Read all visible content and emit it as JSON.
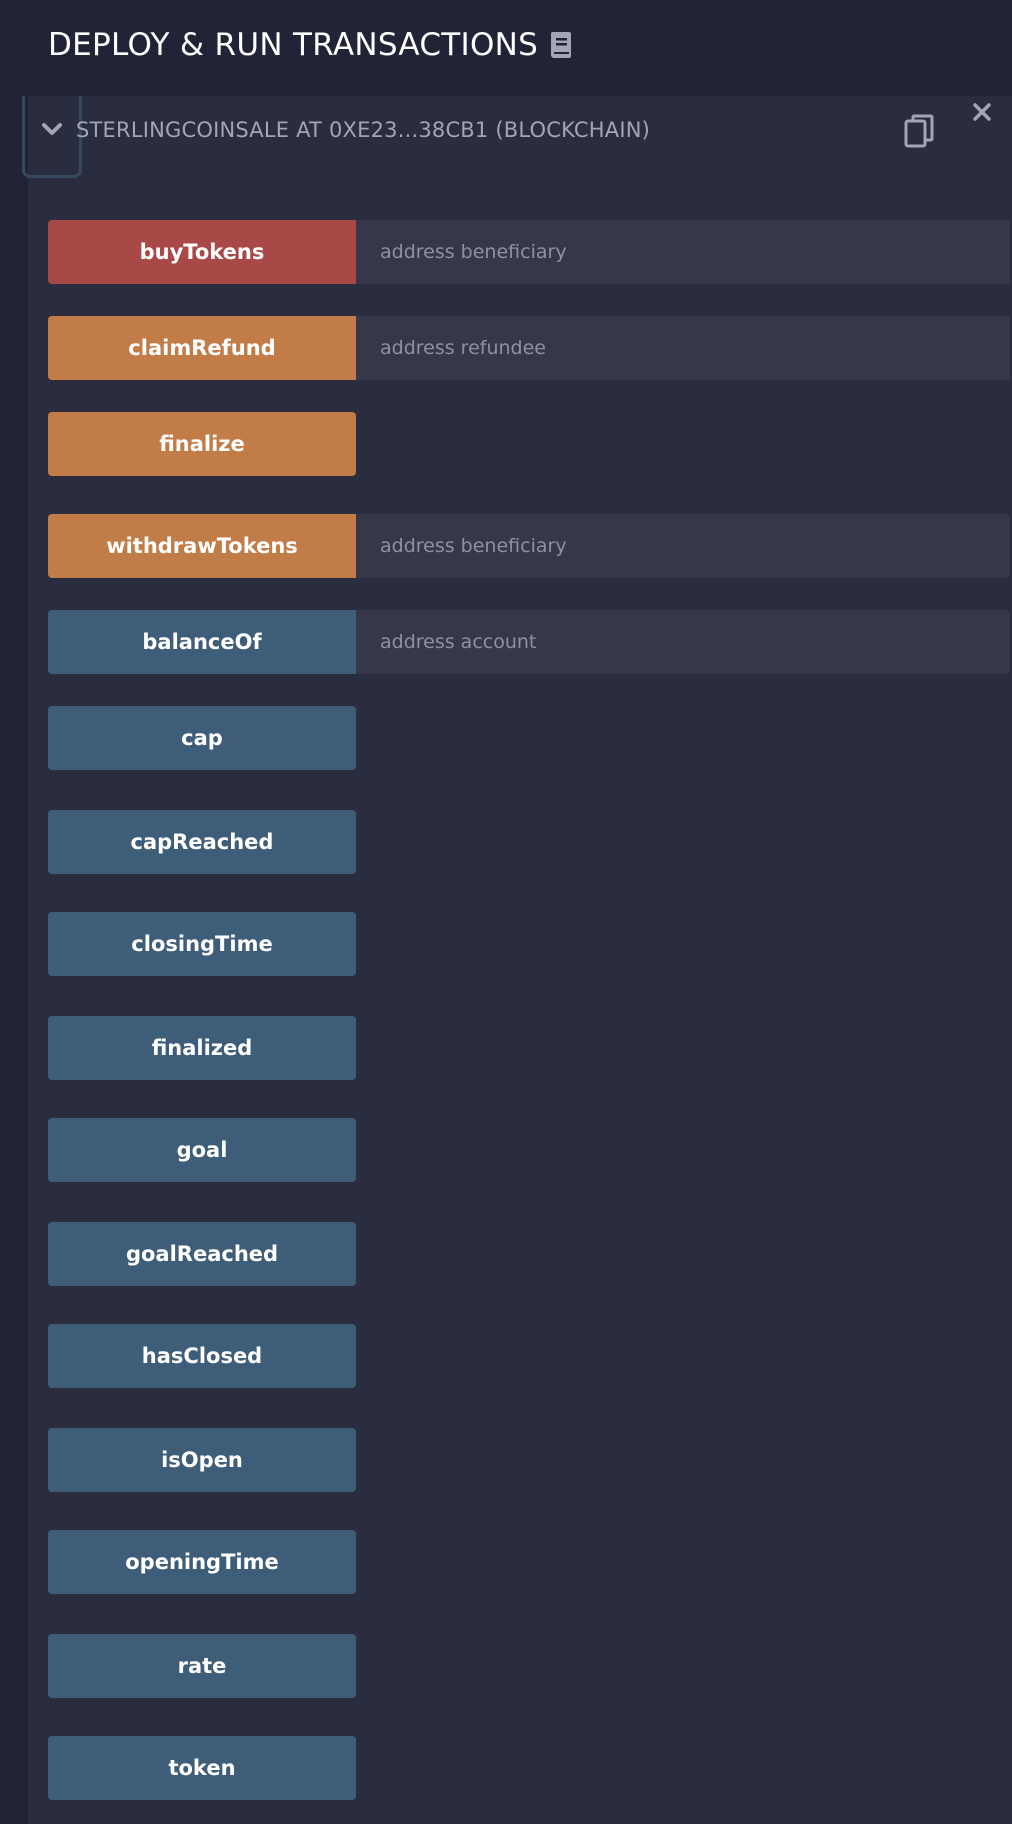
{
  "header": {
    "title": "DEPLOY & RUN TRANSACTIONS",
    "doc_icon": "book-icon"
  },
  "instance": {
    "title": "STERLINGCOINSALE AT 0XE23...38CB1 (BLOCKCHAIN)",
    "toggle_icon": "chevron-down-icon",
    "copy_icon": "copy-icon",
    "close_icon": "close-icon"
  },
  "colors": {
    "payable": "#a84947",
    "transact": "#c27c47",
    "call": "#3e5d79",
    "background": "#2a2c3f",
    "header": "#222336"
  },
  "functions": [
    {
      "label": "buyTokens",
      "kind": "payable",
      "placeholder": "address beneficiary"
    },
    {
      "label": "claimRefund",
      "kind": "transact",
      "placeholder": "address refundee"
    },
    {
      "label": "finalize",
      "kind": "transact"
    },
    {
      "label": "withdrawTokens",
      "kind": "transact",
      "placeholder": "address beneficiary"
    },
    {
      "label": "balanceOf",
      "kind": "call",
      "placeholder": "address account"
    },
    {
      "label": "cap",
      "kind": "call"
    },
    {
      "label": "capReached",
      "kind": "call"
    },
    {
      "label": "closingTime",
      "kind": "call"
    },
    {
      "label": "finalized",
      "kind": "call"
    },
    {
      "label": "goal",
      "kind": "call"
    },
    {
      "label": "goalReached",
      "kind": "call"
    },
    {
      "label": "hasClosed",
      "kind": "call"
    },
    {
      "label": "isOpen",
      "kind": "call"
    },
    {
      "label": "openingTime",
      "kind": "call"
    },
    {
      "label": "rate",
      "kind": "call"
    },
    {
      "label": "token",
      "kind": "call"
    }
  ]
}
